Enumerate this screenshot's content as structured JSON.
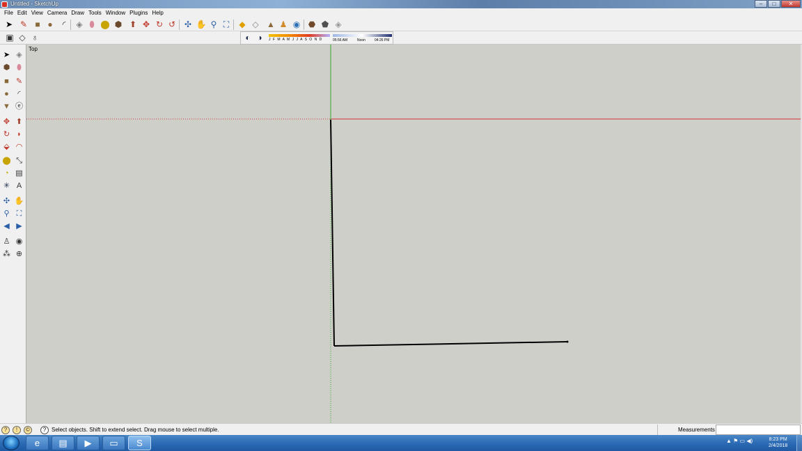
{
  "window": {
    "title": "Untitled - SketchUp",
    "buttons": {
      "minimize": "–",
      "maximize": "□",
      "close": "✕"
    }
  },
  "menu": {
    "items": [
      {
        "label": "File"
      },
      {
        "label": "Edit"
      },
      {
        "label": "View"
      },
      {
        "label": "Camera"
      },
      {
        "label": "Draw"
      },
      {
        "label": "Tools"
      },
      {
        "label": "Window"
      },
      {
        "label": "Plugins"
      },
      {
        "label": "Help"
      }
    ]
  },
  "toolbar": {
    "icons": [
      {
        "name": "select-icon",
        "glyph": "➤",
        "color": "#000000"
      },
      {
        "name": "pencil-icon",
        "glyph": "✎",
        "color": "#c0392b"
      },
      {
        "name": "rectangle-icon",
        "glyph": "■",
        "color": "#8a6a3a"
      },
      {
        "name": "circle-icon",
        "glyph": "●",
        "color": "#8a6a3a"
      },
      {
        "name": "arc-icon",
        "glyph": "◜",
        "color": "#333333"
      },
      {
        "name": "make-component-icon",
        "glyph": "◈",
        "color": "#808080"
      },
      {
        "name": "eraser-icon",
        "glyph": "⬮",
        "color": "#d98a9a"
      },
      {
        "name": "tape-measure-icon",
        "glyph": "⬤",
        "color": "#c8a400"
      },
      {
        "name": "paint-bucket-icon",
        "glyph": "⬢",
        "color": "#6a4a2a"
      },
      {
        "name": "push-pull-icon",
        "glyph": "⬆",
        "color": "#a0402a"
      },
      {
        "name": "move-icon",
        "glyph": "✥",
        "color": "#c0392b"
      },
      {
        "name": "rotate-icon",
        "glyph": "↻",
        "color": "#c0392b"
      },
      {
        "name": "follow-me-icon",
        "glyph": "↺",
        "color": "#c0392b"
      },
      {
        "name": "orbit-icon",
        "glyph": "✣",
        "color": "#2a5fa8"
      },
      {
        "name": "pan-icon",
        "glyph": "✋",
        "color": "#555555"
      },
      {
        "name": "zoom-icon",
        "glyph": "⚲",
        "color": "#2a5fa8"
      },
      {
        "name": "zoom-extents-icon",
        "glyph": "⛶",
        "color": "#2a5fa8"
      },
      {
        "name": "get-models-icon",
        "glyph": "◆",
        "color": "#e0a000"
      },
      {
        "name": "share-model-icon",
        "glyph": "◇",
        "color": "#808080"
      },
      {
        "name": "building-maker-icon",
        "glyph": "▲",
        "color": "#8a6a3a"
      },
      {
        "name": "photo-textures-icon",
        "glyph": "♟",
        "color": "#d08a2a"
      },
      {
        "name": "preview-google-earth-icon",
        "glyph": "◉",
        "color": "#2a6fb8"
      },
      {
        "name": "extension-warehouse-icon",
        "glyph": "⬣",
        "color": "#704a2a"
      },
      {
        "name": "send-to-layout-icon",
        "glyph": "⬟",
        "color": "#505050"
      },
      {
        "name": "style-icon",
        "glyph": "◈",
        "color": "#999999"
      }
    ]
  },
  "toolbar2": {
    "icons": [
      {
        "name": "section-plane-icon",
        "glyph": "▣",
        "color": "#333333"
      },
      {
        "name": "display-section-planes-icon",
        "glyph": "◇",
        "color": "#333333"
      },
      {
        "name": "display-section-cuts-icon",
        "glyph": "♁",
        "color": "#333333"
      }
    ]
  },
  "shadows": {
    "icons": [
      {
        "name": "shadow-settings-icon",
        "glyph": "◐",
        "color": "#203050"
      },
      {
        "name": "display-shadows-icon",
        "glyph": "◑",
        "color": "#203050"
      }
    ],
    "months": "J F M A M J J A S O N D",
    "time_start": "05:56 AM",
    "time_mid": "Noon",
    "time_end": "04:26 PM"
  },
  "left_toolbar": {
    "icons": [
      {
        "name": "select-icon",
        "glyph": "➤",
        "color": "#000000"
      },
      {
        "name": "make-component-icon",
        "glyph": "◈",
        "color": "#808080"
      },
      {
        "name": "paint-bucket-icon",
        "glyph": "⬢",
        "color": "#6a4a2a"
      },
      {
        "name": "eraser-icon",
        "glyph": "⬮",
        "color": "#d98a9a"
      },
      {
        "name": "rectangle-icon",
        "glyph": "■",
        "color": "#8a6a3a"
      },
      {
        "name": "line-icon",
        "glyph": "✎",
        "color": "#c0392b"
      },
      {
        "name": "circle-icon",
        "glyph": "●",
        "color": "#8a6a3a"
      },
      {
        "name": "arc-icon",
        "glyph": "◜",
        "color": "#333333"
      },
      {
        "name": "polygon-icon",
        "glyph": "▼",
        "color": "#8a6a3a"
      },
      {
        "name": "freehand-icon",
        "glyph": "ⓔ",
        "color": "#333333"
      },
      {
        "name": "move-icon",
        "glyph": "✥",
        "color": "#c0392b"
      },
      {
        "name": "push-pull-icon",
        "glyph": "⬆",
        "color": "#a0402a"
      },
      {
        "name": "rotate-icon",
        "glyph": "↻",
        "color": "#c0392b"
      },
      {
        "name": "follow-me-icon",
        "glyph": "◗",
        "color": "#c0392b"
      },
      {
        "name": "scale-icon",
        "glyph": "⬙",
        "color": "#c0392b"
      },
      {
        "name": "offset-icon",
        "glyph": "◠",
        "color": "#c0392b"
      },
      {
        "name": "tape-measure-icon",
        "glyph": "⬤",
        "color": "#c8a400"
      },
      {
        "name": "dimension-icon",
        "glyph": "⤡",
        "color": "#333333"
      },
      {
        "name": "protractor-icon",
        "glyph": "◔",
        "color": "#c8a400"
      },
      {
        "name": "text-icon",
        "glyph": "▤",
        "color": "#333333"
      },
      {
        "name": "axes-icon",
        "glyph": "✳",
        "color": "#203050"
      },
      {
        "name": "3d-text-icon",
        "glyph": "A",
        "color": "#333333"
      },
      {
        "name": "orbit-icon",
        "glyph": "✣",
        "color": "#2a5fa8"
      },
      {
        "name": "pan-icon",
        "glyph": "✋",
        "color": "#555555"
      },
      {
        "name": "zoom-icon",
        "glyph": "⚲",
        "color": "#2a5fa8"
      },
      {
        "name": "zoom-window-icon",
        "glyph": "⛶",
        "color": "#2a5fa8"
      },
      {
        "name": "previous-view-icon",
        "glyph": "◀",
        "color": "#2a5fa8"
      },
      {
        "name": "next-view-icon",
        "glyph": "▶",
        "color": "#2a5fa8"
      },
      {
        "name": "position-camera-icon",
        "glyph": "♙",
        "color": "#333333"
      },
      {
        "name": "look-around-icon",
        "glyph": "◉",
        "color": "#333333"
      },
      {
        "name": "walk-icon",
        "glyph": "⁂",
        "color": "#333333"
      },
      {
        "name": "section-plane-icon",
        "glyph": "⊕",
        "color": "#333333"
      }
    ]
  },
  "viewport": {
    "view_name": "Top",
    "colors": {
      "background": "#cfcfc9",
      "red_axis": "#cc3333",
      "green_axis": "#33aa33",
      "edge": "#000000"
    }
  },
  "status": {
    "text": "Select objects. Shift to extend select. Drag mouse to select multiple.",
    "help_glyph": "?",
    "indicator_glyphs": [
      "?",
      "!",
      "©"
    ],
    "measurements_label": "Measurements",
    "measurements_value": ""
  },
  "taskbar": {
    "apps": [
      {
        "name": "internet-explorer-icon",
        "glyph": "e",
        "active": false
      },
      {
        "name": "file-explorer-icon",
        "glyph": "▤",
        "active": false
      },
      {
        "name": "media-player-icon",
        "glyph": "▶",
        "active": false
      },
      {
        "name": "folder-icon",
        "glyph": "▭",
        "active": false
      },
      {
        "name": "sketchup-icon",
        "glyph": "S",
        "active": true
      }
    ],
    "tray_glyphs": "▲ ⚑ ▭ ◀)",
    "time": "8:23 PM",
    "date": "2/4/2018"
  }
}
